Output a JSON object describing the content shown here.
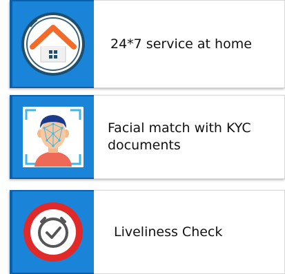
{
  "features": [
    {
      "icon": "home-icon",
      "label": "24*7 service at home"
    },
    {
      "icon": "face-scan-icon",
      "label": "Facial match with KYC documents"
    },
    {
      "icon": "clock-check-icon",
      "label": "Liveliness Check"
    }
  ],
  "colors": {
    "icon_panel": "#1a84d8",
    "icon_panel_border": "#0b5fa8",
    "house_roof": "#f26b2a",
    "badge_red": "#e02a2a"
  }
}
